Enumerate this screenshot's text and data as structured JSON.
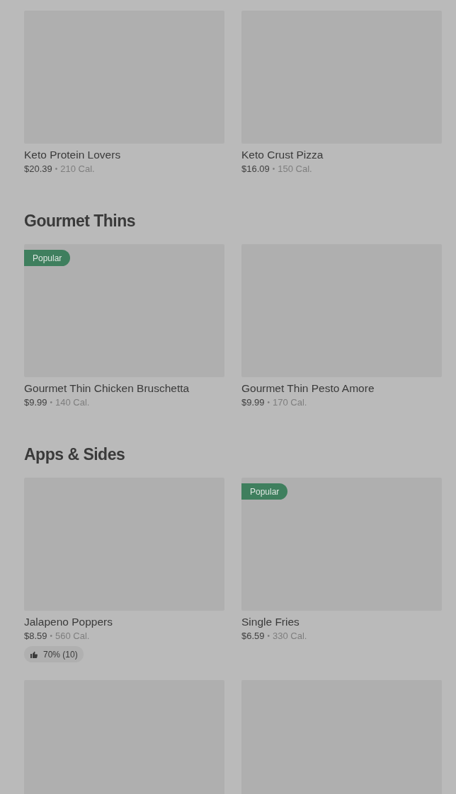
{
  "sections": [
    {
      "items": [
        {
          "title": "Keto Protein Lovers",
          "price": "$20.39",
          "separator": "•",
          "calories": "210 Cal.",
          "popular": false
        },
        {
          "title": "Keto Crust Pizza",
          "price": "$16.09",
          "separator": "•",
          "calories": "150 Cal.",
          "popular": false
        }
      ]
    },
    {
      "heading": "Gourmet Thins",
      "items": [
        {
          "title": "Gourmet Thin Chicken Bruschetta",
          "price": "$9.99",
          "separator": "•",
          "calories": "140 Cal.",
          "popular": true,
          "badge": "Popular"
        },
        {
          "title": "Gourmet Thin Pesto Amore",
          "price": "$9.99",
          "separator": "•",
          "calories": "170 Cal.",
          "popular": false
        }
      ]
    },
    {
      "heading": "Apps & Sides",
      "items": [
        {
          "title": "Jalapeno Poppers",
          "price": "$8.59",
          "separator": "•",
          "calories": "560 Cal.",
          "popular": false,
          "rating": "70% (10)"
        },
        {
          "title": "Single Fries",
          "price": "$6.59",
          "separator": "•",
          "calories": "330 Cal.",
          "popular": true,
          "badge": "Popular"
        },
        {
          "popular": false
        },
        {
          "popular": false
        }
      ]
    }
  ]
}
